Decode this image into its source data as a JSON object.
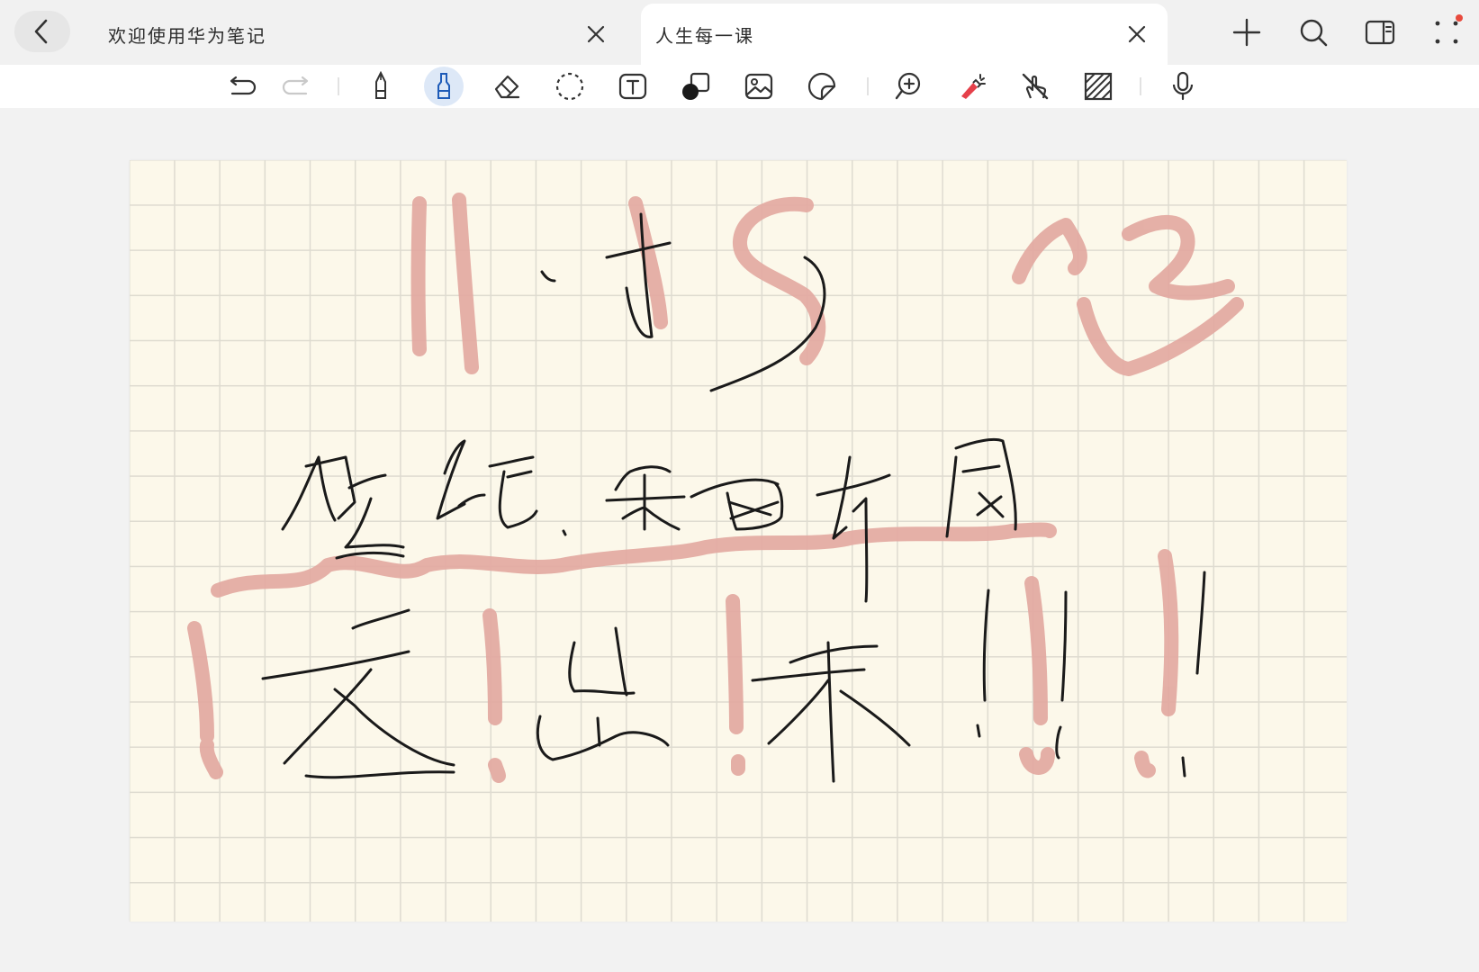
{
  "tabs": {
    "first_title": "欢迎使用华为笔记",
    "second_title": "人生每一课"
  },
  "icons": {
    "back": "chevron-left-icon",
    "close": "close-icon",
    "add": "plus-icon",
    "search": "search-icon",
    "split": "split-view-icon",
    "more": "apps-grid-icon"
  },
  "toolbar": {
    "tools": [
      "undo",
      "redo",
      "pen",
      "highlighter",
      "eraser",
      "lasso",
      "text",
      "shape",
      "image",
      "sticker",
      "zoom",
      "laser-pointer",
      "touch-draw",
      "background-pattern",
      "voice"
    ],
    "selected_tool": "highlighter"
  },
  "colors": {
    "ink": "#1a1a1a",
    "highlighter": "#e3a9a1",
    "selected_tool_bg": "#dde8f7",
    "paper": "#fcf8ea",
    "grid": "#dedbd0",
    "notification_dot": "#e84a3d"
  },
  "page": {
    "background": "grid"
  }
}
